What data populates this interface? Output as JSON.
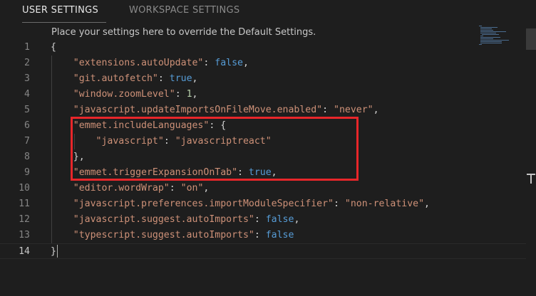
{
  "tabs": {
    "user": "USER SETTINGS",
    "workspace": "WORKSPACE SETTINGS"
  },
  "hint": "Place your settings here to override the Default Settings.",
  "colors": {
    "background": "#1e1e1e",
    "string": "#ce9178",
    "keyword": "#569cd6",
    "number": "#b5cea8",
    "highlight": "#e8262a"
  },
  "lines": [
    {
      "n": "1",
      "t": [
        {
          "c": "p",
          "v": "{"
        }
      ]
    },
    {
      "n": "2",
      "t": [
        {
          "c": "p",
          "v": "    "
        },
        {
          "c": "k",
          "v": "\"extensions.autoUpdate\""
        },
        {
          "c": "p",
          "v": ": "
        },
        {
          "c": "b",
          "v": "false"
        },
        {
          "c": "p",
          "v": ","
        }
      ]
    },
    {
      "n": "3",
      "t": [
        {
          "c": "p",
          "v": "    "
        },
        {
          "c": "k",
          "v": "\"git.autofetch\""
        },
        {
          "c": "p",
          "v": ": "
        },
        {
          "c": "b",
          "v": "true"
        },
        {
          "c": "p",
          "v": ","
        }
      ]
    },
    {
      "n": "4",
      "t": [
        {
          "c": "p",
          "v": "    "
        },
        {
          "c": "k",
          "v": "\"window.zoomLevel\""
        },
        {
          "c": "p",
          "v": ": "
        },
        {
          "c": "n",
          "v": "1"
        },
        {
          "c": "p",
          "v": ","
        }
      ]
    },
    {
      "n": "5",
      "t": [
        {
          "c": "p",
          "v": "    "
        },
        {
          "c": "k",
          "v": "\"javascript.updateImportsOnFileMove.enabled\""
        },
        {
          "c": "p",
          "v": ": "
        },
        {
          "c": "s",
          "v": "\"never\""
        },
        {
          "c": "p",
          "v": ","
        }
      ]
    },
    {
      "n": "6",
      "t": [
        {
          "c": "p",
          "v": "    "
        },
        {
          "c": "k",
          "v": "\"emmet.includeLanguages\""
        },
        {
          "c": "p",
          "v": ": {"
        }
      ]
    },
    {
      "n": "7",
      "t": [
        {
          "c": "p",
          "v": "        "
        },
        {
          "c": "k",
          "v": "\"javascript\""
        },
        {
          "c": "p",
          "v": ": "
        },
        {
          "c": "s",
          "v": "\"javascriptreact\""
        }
      ]
    },
    {
      "n": "8",
      "t": [
        {
          "c": "p",
          "v": "    },"
        }
      ]
    },
    {
      "n": "9",
      "t": [
        {
          "c": "p",
          "v": "    "
        },
        {
          "c": "k",
          "v": "\"emmet.triggerExpansionOnTab\""
        },
        {
          "c": "p",
          "v": ": "
        },
        {
          "c": "b",
          "v": "true"
        },
        {
          "c": "p",
          "v": ","
        }
      ]
    },
    {
      "n": "10",
      "t": [
        {
          "c": "p",
          "v": "    "
        },
        {
          "c": "k",
          "v": "\"editor.wordWrap\""
        },
        {
          "c": "p",
          "v": ": "
        },
        {
          "c": "s",
          "v": "\"on\""
        },
        {
          "c": "p",
          "v": ","
        }
      ]
    },
    {
      "n": "11",
      "t": [
        {
          "c": "p",
          "v": "    "
        },
        {
          "c": "k",
          "v": "\"javascript.preferences.importModuleSpecifier\""
        },
        {
          "c": "p",
          "v": ": "
        },
        {
          "c": "s",
          "v": "\"non-relative\""
        },
        {
          "c": "p",
          "v": ","
        }
      ]
    },
    {
      "n": "12",
      "t": [
        {
          "c": "p",
          "v": "    "
        },
        {
          "c": "k",
          "v": "\"javascript.suggest.autoImports\""
        },
        {
          "c": "p",
          "v": ": "
        },
        {
          "c": "b",
          "v": "false"
        },
        {
          "c": "p",
          "v": ","
        }
      ]
    },
    {
      "n": "13",
      "t": [
        {
          "c": "p",
          "v": "    "
        },
        {
          "c": "k",
          "v": "\"typescript.suggest.autoImports\""
        },
        {
          "c": "p",
          "v": ": "
        },
        {
          "c": "b",
          "v": "false"
        }
      ]
    },
    {
      "n": "14",
      "t": [
        {
          "c": "p",
          "v": "}"
        }
      ]
    }
  ],
  "current_line": "14"
}
